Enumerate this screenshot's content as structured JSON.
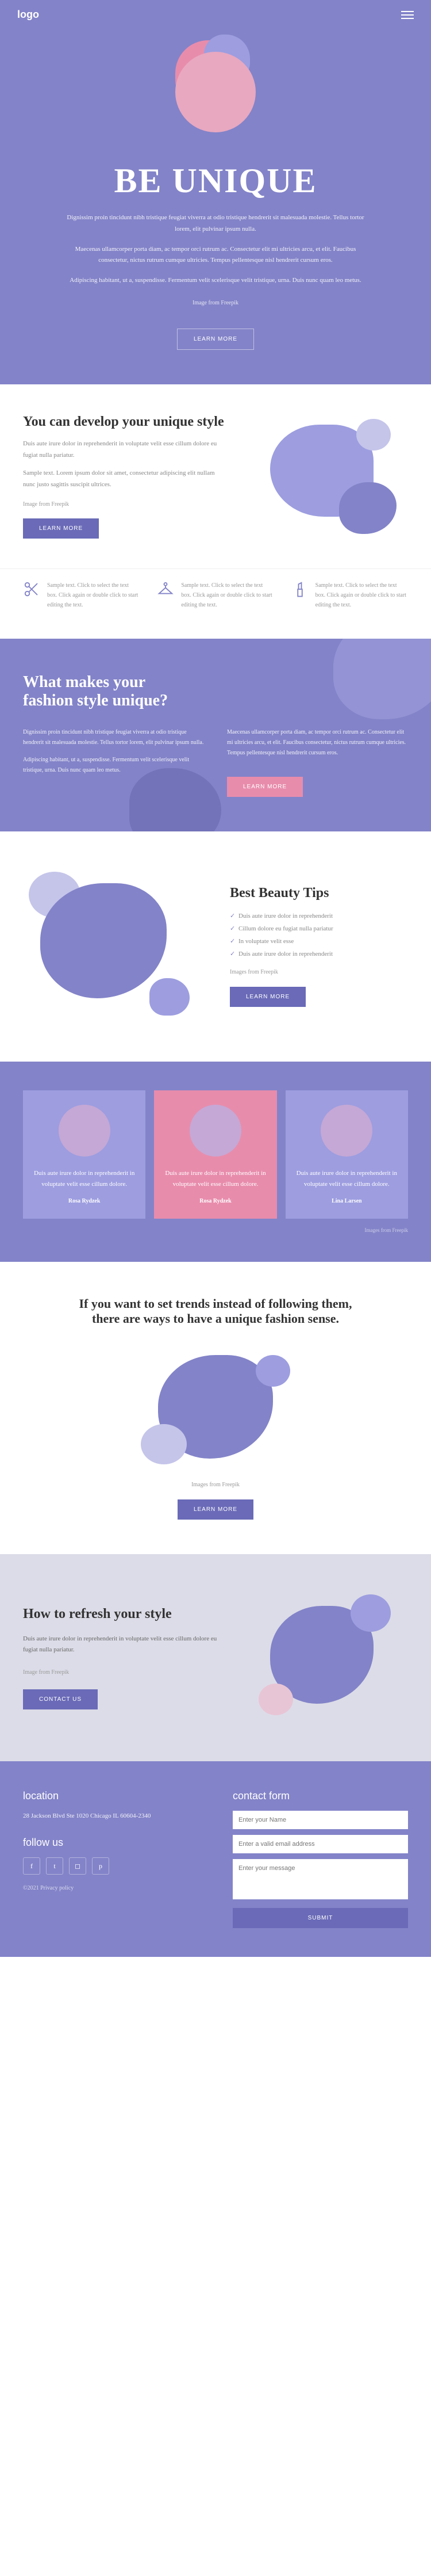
{
  "header": {
    "logo": "logo"
  },
  "hero": {
    "title": "BE UNIQUE",
    "p1": "Dignissim proin tincidunt nibh tristique feugiat viverra at odio tristique hendrerit sit malesuada molestie. Tellus tortor lorem, elit pulvinar ipsum nulla.",
    "p2": "Maecenas ullamcorper porta diam, ac tempor orci rutrum ac. Consectetur elit mi ultricies arcu, et elit. Faucibus consectetur, nictus rutrum cumque ultricies. Tempus pellentesque nisl hendrerit cursum eros.",
    "p3": "Adipiscing habitant, ut a, suspendisse. Fermentum velit scelerisque velit tristique, urna. Duis nunc quam leo metus.",
    "credit": "Image from Freepik",
    "btn": "LEARN MORE"
  },
  "sec2": {
    "title": "You can develop your unique style",
    "p1": "Duis aute irure dolor in reprehenderit in voluptate velit esse cillum dolore eu fugiat nulla pariatur.",
    "p2": "Sample text. Lorem ipsum dolor sit amet, consectetur adipiscing elit nullam nunc justo sagittis suscipit ultrices.",
    "credit": "Image from Freepik",
    "btn": "LEARN MORE"
  },
  "cols": [
    {
      "text": "Sample text. Click to select the text box. Click again or double click to start editing the text."
    },
    {
      "text": "Sample text. Click to select the text box. Click again or double click to start editing the text."
    },
    {
      "text": "Sample text. Click to select the text box. Click again or double click to start editing the text."
    }
  ],
  "sec3": {
    "title": "What makes your fashion style unique?",
    "l1": "Dignissim proin tincidunt nibh tristique feugiat viverra at odio tristique hendrerit sit malesuada molestie. Tellus tortor lorem, elit pulvinar ipsum nulla.",
    "l2": "Adipiscing habitant, ut a, suspendisse. Fermentum velit scelerisque velit tristique, urna. Duis nunc quam leo metus.",
    "r1": "Maecenas ullamcorper porta diam, ac tempor orci rutrum ac. Consectetur elit mi ultricies arcu, et elit. Faucibus consectetur, nictus rutrum cumque ultricies. Tempus pellentesque nisl hendrerit cursum eros.",
    "btn": "LEARN MORE"
  },
  "sec4": {
    "title": "Best Beauty Tips",
    "items": [
      "Duis aute irure dolor in reprehenderit",
      "Cillum dolore eu fugiat nulla pariatur",
      "In voluptate velit esse",
      "Duis aute irure dolor in reprehenderit"
    ],
    "credit": "Images from Freepik",
    "btn": "LEARN MORE"
  },
  "testimonials": [
    {
      "text": "Duis aute irure dolor in reprehenderit in voluptate velit esse cillum dolore.",
      "name": "Rosa Rydzek"
    },
    {
      "text": "Duis aute irure dolor in reprehenderit in voluptate velit esse cillum dolore.",
      "name": "Rosa Rydzek"
    },
    {
      "text": "Duis aute irure dolor in reprehenderit in voluptate velit esse cillum dolore.",
      "name": "Lina Larsen"
    }
  ],
  "test_credit": "Images from Freepik",
  "sec6": {
    "title": "If you want to set trends instead of following them, there are ways to have a unique fashion sense.",
    "credit": "Images from Freepik",
    "btn": "LEARN MORE"
  },
  "sec7": {
    "title": "How to refresh your style",
    "p1": "Duis aute irure dolor in reprehenderit in voluptate velit esse cillum dolore eu fugiat nulla pariatur.",
    "credit": "Image from Freepik",
    "btn": "CONTACT US"
  },
  "footer": {
    "loc_title": "location",
    "address": "28 Jackson Blvd Ste 1020 Chicago IL 60604-2340",
    "follow_title": "follow us",
    "copy": "©2021 Privacy policy",
    "form_title": "contact form",
    "name_ph": "Enter your Name",
    "email_ph": "Enter a valid email address",
    "msg_ph": "Enter your message",
    "submit": "SUBMIT"
  }
}
